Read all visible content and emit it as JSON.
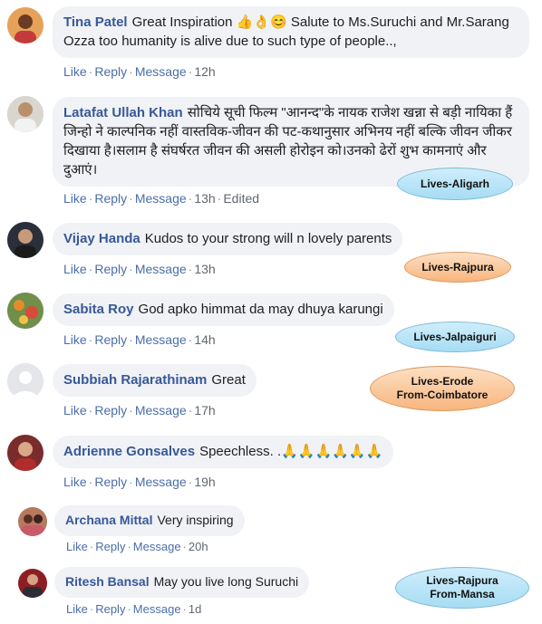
{
  "comments": [
    {
      "name": "Tina Patel",
      "text": "Great Inspiration 👍👌😊 Salute to Ms.Suruchi and Mr.Sarang Ozza too humanity is alive due to such type of people..,",
      "like": "Like",
      "reply": "Reply",
      "message": "Message",
      "time": "12h",
      "edited": ""
    },
    {
      "name": "Latafat Ullah Khan",
      "text": "सोचिये सूची फिल्म \"आनन्द\"के नायक राजेश खन्ना से बड़ी नायिका हैं जिन्हो ने काल्पनिक नहीं वास्तविक-जीवन की पट-कथानुसार अभिनय नहीं बल्कि जीवन जीकर दिखाया है।सलाम है संघर्षरत जीवन की असली होरोइन को।उनको ढेरों शुभ कामनाएं और दुआएं।",
      "like": "Like",
      "reply": "Reply",
      "message": "Message",
      "time": "13h",
      "edited": "Edited"
    },
    {
      "name": "Vijay Handa",
      "text": "Kudos to your strong will n lovely parents",
      "like": "Like",
      "reply": "Reply",
      "message": "Message",
      "time": "13h",
      "edited": ""
    },
    {
      "name": "Sabita Roy",
      "text": "God apko himmat da may dhuya karungi",
      "like": "Like",
      "reply": "Reply",
      "message": "Message",
      "time": "14h",
      "edited": ""
    },
    {
      "name": "Subbiah Rajarathinam",
      "text": "Great",
      "like": "Like",
      "reply": "Reply",
      "message": "Message",
      "time": "17h",
      "edited": ""
    },
    {
      "name": "Adrienne Gonsalves",
      "text": "Speechless. .🙏🙏🙏🙏🙏🙏",
      "like": "Like",
      "reply": "Reply",
      "message": "Message",
      "time": "19h",
      "edited": ""
    },
    {
      "name": "Archana Mittal",
      "text": "Very inspiring",
      "like": "Like",
      "reply": "Reply",
      "message": "Message",
      "time": "20h",
      "edited": ""
    },
    {
      "name": "Ritesh Bansal",
      "text": "May you live long Suruchi",
      "like": "Like",
      "reply": "Reply",
      "message": "Message",
      "time": "1d",
      "edited": ""
    }
  ],
  "tags": [
    {
      "line1": "Lives-Aligarh",
      "line2": "",
      "style": "blue"
    },
    {
      "line1": "Lives-Rajpura",
      "line2": "",
      "style": "orange"
    },
    {
      "line1": "Lives-Jalpaiguri",
      "line2": "",
      "style": "blue"
    },
    {
      "line1": "Lives-Erode",
      "line2": "From-Coimbatore",
      "style": "orange"
    },
    {
      "line1": "Lives-Rajpura",
      "line2": "From-Mansa",
      "style": "blue"
    }
  ],
  "colors": {
    "name": "#385898",
    "bubble": "#f0f2f5",
    "link": "#4b6ea9",
    "tag_blue": "#b8e4f6",
    "tag_orange": "#f9c89a"
  }
}
